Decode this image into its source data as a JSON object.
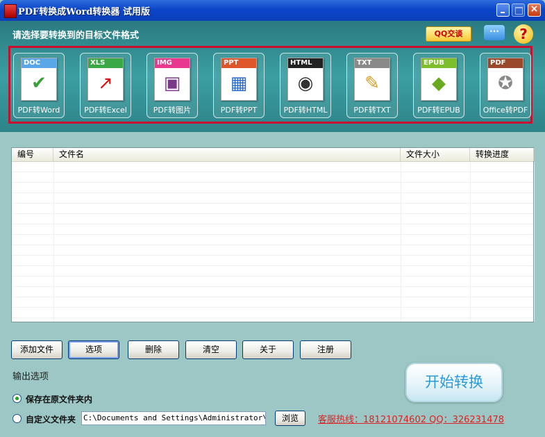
{
  "window": {
    "title": "PDF转换成Word转换器 试用版"
  },
  "header": {
    "prompt": "请选择要转换到的目标文件格式",
    "qq_label": "QQ交谈",
    "icons": [
      "chat-icon",
      "help-icon"
    ]
  },
  "formats": [
    {
      "tag": "DOC",
      "label": "PDF转Word",
      "color": "#5aa7e8",
      "glyph": "✔"
    },
    {
      "tag": "XLS",
      "label": "PDF转Excel",
      "color": "#39a845",
      "glyph": "↗"
    },
    {
      "tag": "IMG",
      "label": "PDF转图片",
      "color": "#e8398f",
      "glyph": "▣"
    },
    {
      "tag": "PPT",
      "label": "PDF转PPT",
      "color": "#e0562b",
      "glyph": "▦"
    },
    {
      "tag": "HTML",
      "label": "PDF转HTML",
      "color": "#222222",
      "glyph": "◉"
    },
    {
      "tag": "TXT",
      "label": "PDF转TXT",
      "color": "#8a8a8a",
      "glyph": "✎"
    },
    {
      "tag": "EPUB",
      "label": "PDF转EPUB",
      "color": "#7cbf2a",
      "glyph": "◆"
    },
    {
      "tag": "PDF",
      "label": "Office转PDF",
      "color": "#9a4a2a",
      "glyph": "✪"
    }
  ],
  "file_list": {
    "columns": [
      "编号",
      "文件名",
      "文件大小",
      "转换进度"
    ],
    "rows": []
  },
  "actions": {
    "add": "添加文件",
    "options": "选项",
    "delete": "删除",
    "clear": "清空",
    "about": "关于",
    "register": "注册"
  },
  "output": {
    "title": "输出选项",
    "save_original": "保存在原文件夹内",
    "custom_folder": "自定义文件夹",
    "path_value": "C:\\Documents and Settings\\Administrator\\桌面",
    "browse": "浏览"
  },
  "hotline": "客服热线：18121074602 QQ：326231478",
  "start_button": "开始转换"
}
